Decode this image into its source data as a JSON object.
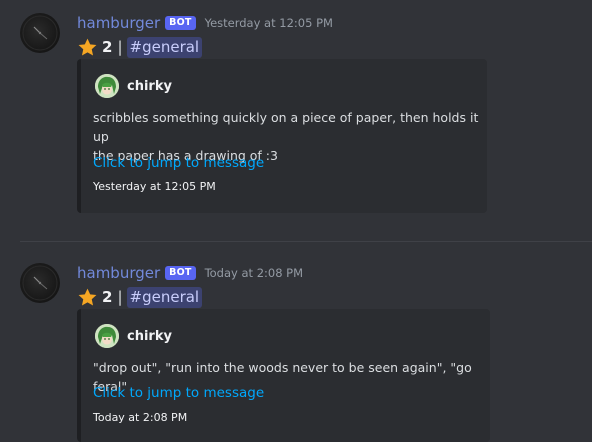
{
  "messages": [
    {
      "author": "hamburger",
      "bot_tag": "BOT",
      "timestamp": "Yesterday at 12:05 PM",
      "star_count": "2",
      "separator": "|",
      "channel_hash": "#",
      "channel": "general",
      "embed": {
        "author": "chirky",
        "description_lines": [
          "scribbles something quickly on a piece of paper, then holds it up",
          "the paper has a drawing of :3"
        ],
        "jump_link": "Click to jump to message",
        "footer": "Yesterday at 12:05 PM"
      }
    },
    {
      "author": "hamburger",
      "bot_tag": "BOT",
      "timestamp": "Today at 2:08 PM",
      "star_count": "2",
      "separator": "|",
      "channel_hash": "#",
      "channel": "general",
      "embed": {
        "author": "chirky",
        "description_lines": [
          "\"drop out\", \"run into the woods never to be seen again\", \"go feral\""
        ],
        "jump_link": "Click to jump to message",
        "footer": "Today at 2:08 PM"
      }
    }
  ],
  "icons": {
    "star": "star-icon",
    "bot_avatar": "clock-avatar",
    "author_avatar": "green-hair-avatar"
  },
  "colors": {
    "background": "#313338",
    "embed_background": "#2b2d31",
    "username": "#7289da",
    "bot_tag": "#5865f2",
    "link": "#00a8fc",
    "mention_bg": "#3c4270",
    "star": "#f5a623"
  }
}
